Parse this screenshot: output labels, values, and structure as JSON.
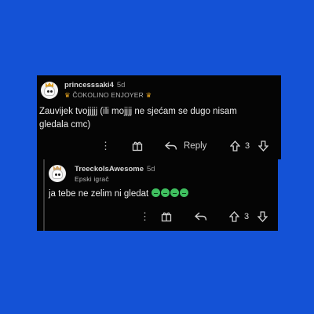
{
  "comments": [
    {
      "username": "princesssaki4",
      "age": "5d",
      "flair_left_icon": "crown-emoji",
      "flair": "ČOKOLINO ENJOYER",
      "flair_right_icon": "crown-emoji",
      "text_line1": "Zauvijek tvojjjjj (ili mojjjj ne sjećam se dugo nisam",
      "text_line2": "gledala cmc)",
      "reply_label": "Reply",
      "vote_count": "3"
    },
    {
      "username": "TreeckoIsAwesome",
      "age": "5d",
      "flair": "Epski igrač",
      "text": "ja tebe ne zelim ni gledat",
      "emojis": [
        "green-face-emoji",
        "green-face-emoji",
        "green-face-emoji",
        "green-face-emoji"
      ],
      "vote_count": "3"
    }
  ],
  "colors": {
    "background": "#1452d6",
    "card": "#050505",
    "text": "#ededed",
    "emoji_green": "#3fbf5f"
  }
}
